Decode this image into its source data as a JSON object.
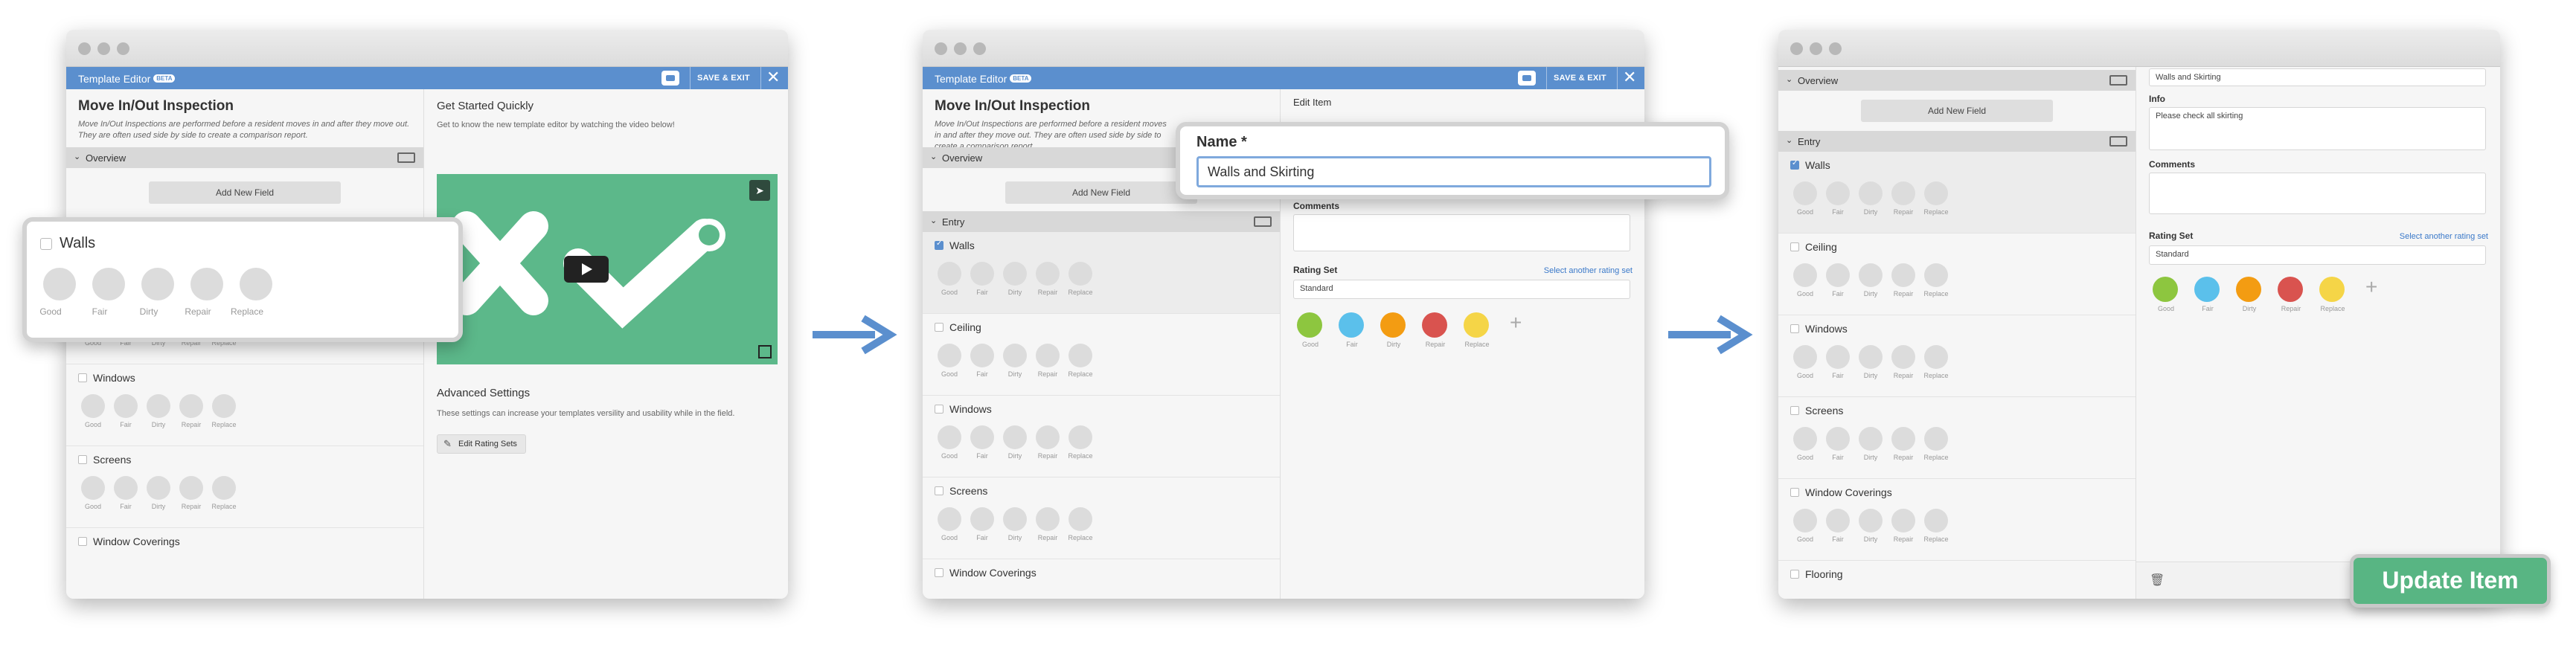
{
  "app": {
    "title": "Template Editor",
    "beta": "BETA",
    "save_exit": "SAVE & EXIT",
    "close": "✕"
  },
  "template": {
    "title": "Move In/Out Inspection",
    "description": "Move In/Out Inspections are performed before a resident moves in and after they move out. They are often used side by side to create a comparison report."
  },
  "sections": {
    "overview": "Overview",
    "entry": "Entry"
  },
  "add_new_field": "Add New Field",
  "rating_labels": [
    "Good",
    "Fair",
    "Dirty",
    "Repair",
    "Replace"
  ],
  "items": [
    "Walls",
    "Ceiling",
    "Windows",
    "Screens",
    "Window Coverings",
    "Flooring"
  ],
  "panel1": {
    "get_started_title": "Get Started Quickly",
    "get_started_desc": "Get to know the new template editor by watching the video below!",
    "advanced_title": "Advanced Settings",
    "advanced_desc": "These settings can increase your templates versility and usability while in the field.",
    "edit_rating_sets": "Edit Rating Sets"
  },
  "callout1": {
    "item": "Walls"
  },
  "panel2": {
    "edit_item": "Edit Item",
    "name_label": "Name *",
    "name_value": "Walls and Skirting",
    "comments_label": "Comments",
    "rating_set_label": "Rating Set",
    "select_another": "Select another rating set",
    "rating_set_value": "Standard"
  },
  "panel3": {
    "name_value": "Walls and Skirting",
    "info_label": "Info",
    "info_value": "Please check all skirting",
    "comments_label": "Comments",
    "rating_set_label": "Rating Set",
    "select_another": "Select another rating set",
    "rating_set_value": "Standard",
    "update_button": "Update Item"
  },
  "colors": {
    "accent": "#5b8fce",
    "good": "#8dc63f",
    "fair": "#5bc0eb",
    "dirty": "#f39c12",
    "repair": "#d9534f",
    "replace": "#f5d547",
    "video_bg": "#5cb88a",
    "update_button": "#58b583"
  },
  "icons": [
    "search-icon",
    "chat-icon",
    "close-icon",
    "keyboard-icon",
    "play-icon",
    "send-icon",
    "fullscreen-icon",
    "trash-icon",
    "plus-icon",
    "arrow-right-icon"
  ]
}
